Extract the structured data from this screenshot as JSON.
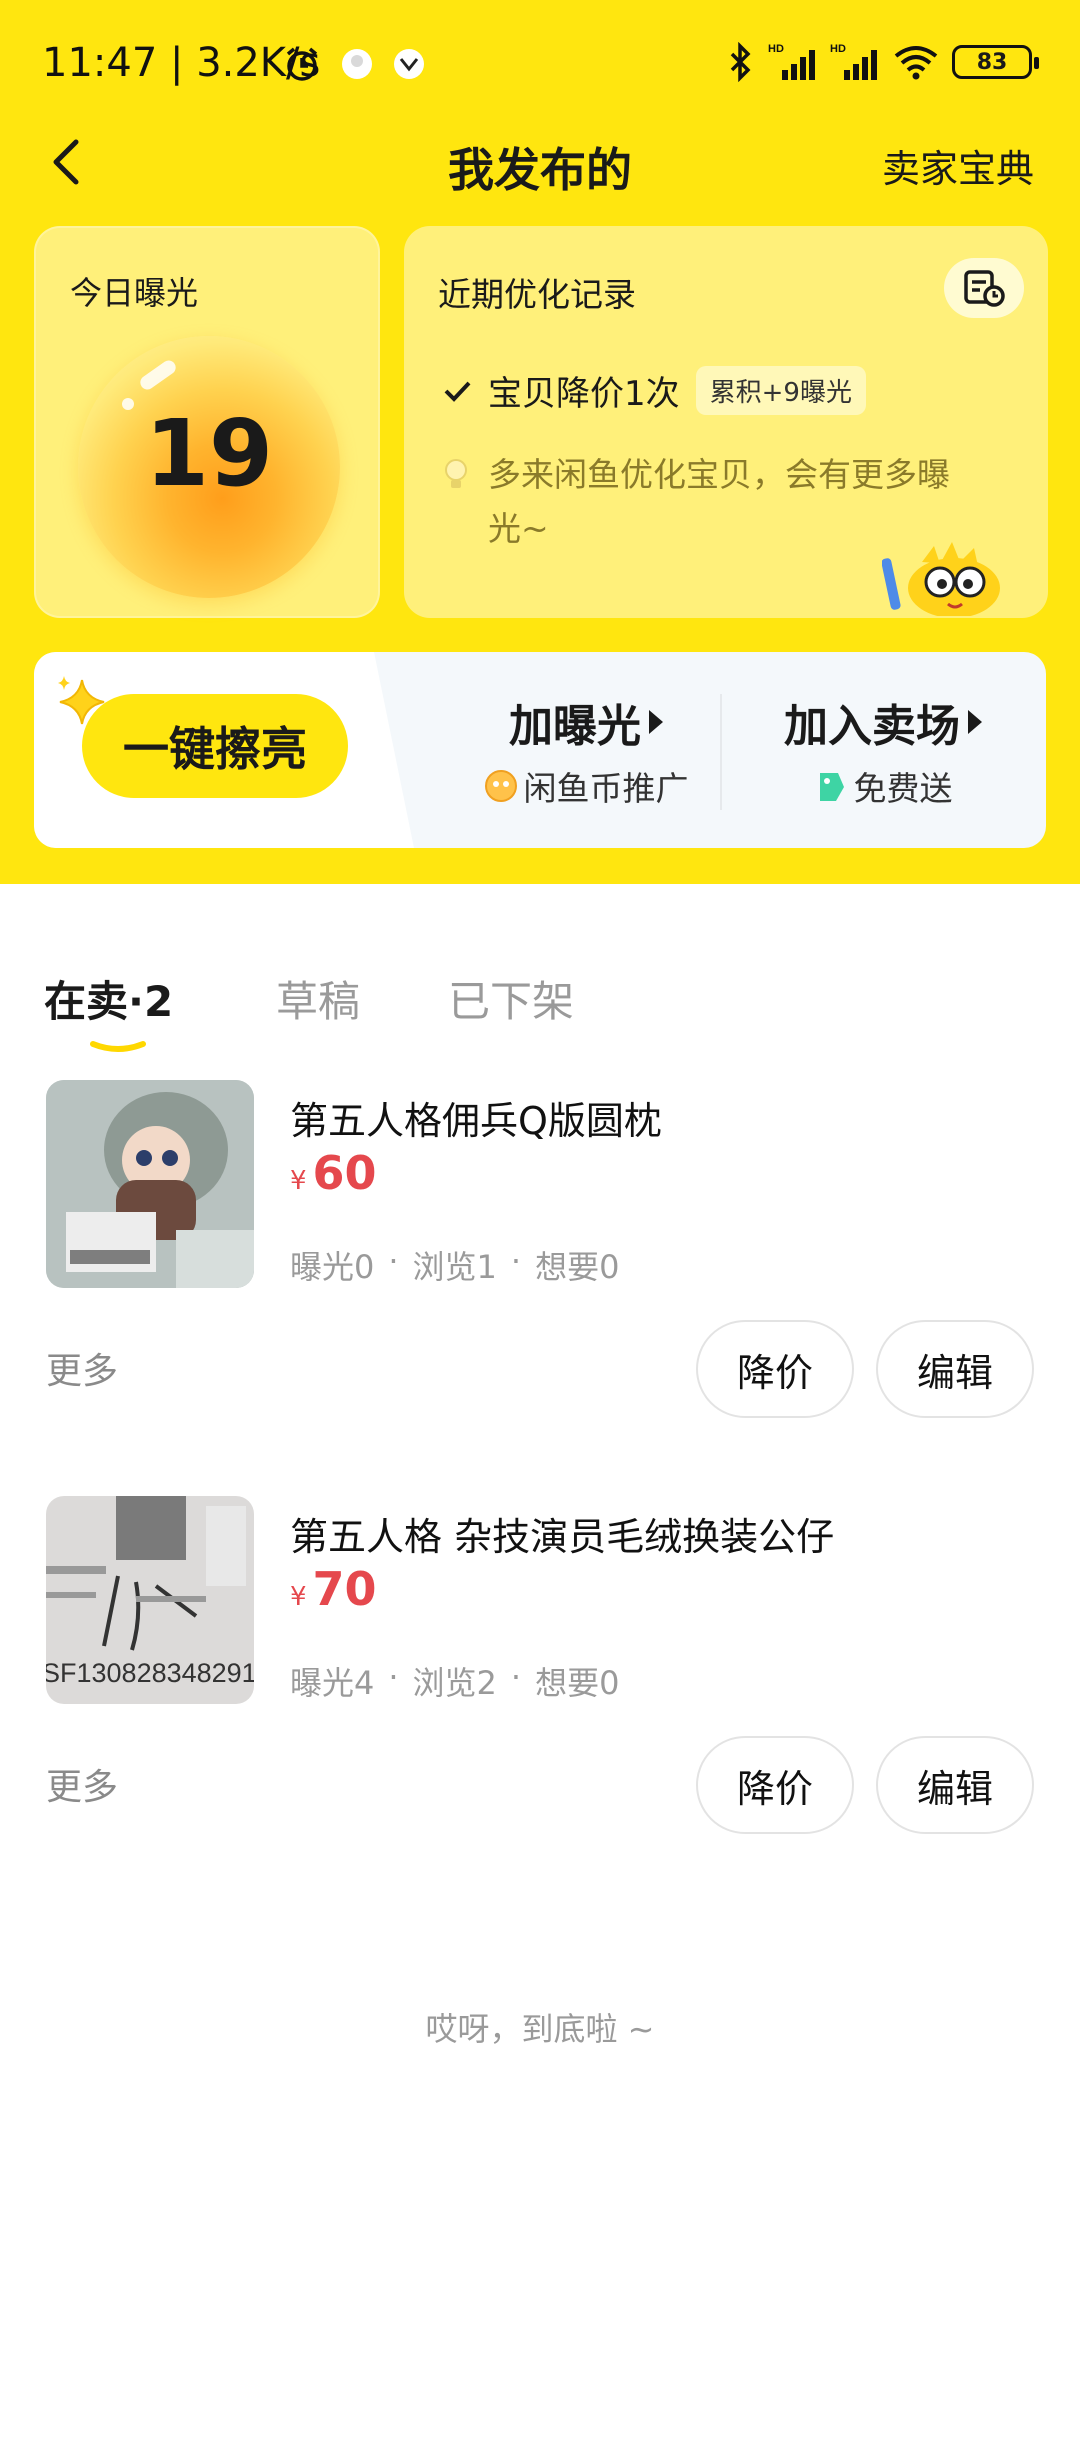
{
  "status_bar": {
    "time": "11:47",
    "speed": "3.2K/s",
    "battery": "83",
    "signal_labels": [
      "HD",
      "HD"
    ]
  },
  "nav": {
    "title": "我发布的",
    "right_link": "卖家宝典"
  },
  "exposure_card": {
    "label": "今日曝光",
    "count": "19"
  },
  "records_card": {
    "title": "近期优化记录",
    "record_text": "宝贝降价1次",
    "record_badge": "累积+9曝光",
    "tip": "多来闲鱼优化宝贝，会有更多曝光~"
  },
  "action_bar": {
    "polish_label": "一键擦亮",
    "boost_label": "加曝光",
    "boost_sub": "闲鱼币推广",
    "market_label": "加入卖场",
    "market_sub": "免费送"
  },
  "tabs": [
    {
      "label": "在卖·2",
      "active": true
    },
    {
      "label": "草稿",
      "active": false
    },
    {
      "label": "已下架",
      "active": false
    }
  ],
  "listings": [
    {
      "title": "第五人格佣兵Q版圆枕",
      "currency": "¥",
      "price": "60",
      "stats": [
        "曝光0",
        "·",
        "浏览1",
        "·",
        "想要0"
      ],
      "more": "更多",
      "reduce_price": "降价",
      "edit": "编辑"
    },
    {
      "title": "第五人格 杂技演员毛绒换装公仔",
      "currency": "¥",
      "price": "70",
      "stats": [
        "曝光4",
        "·",
        "浏览2",
        "·",
        "想要0"
      ],
      "more": "更多",
      "reduce_price": "降价",
      "edit": "编辑",
      "thumb_text": "SF130828348291"
    }
  ],
  "footer": {
    "end_text": "哎呀，到底啦 ~"
  },
  "colors": {
    "brand_yellow": "#FFE60F",
    "price_red": "#E5484D"
  }
}
